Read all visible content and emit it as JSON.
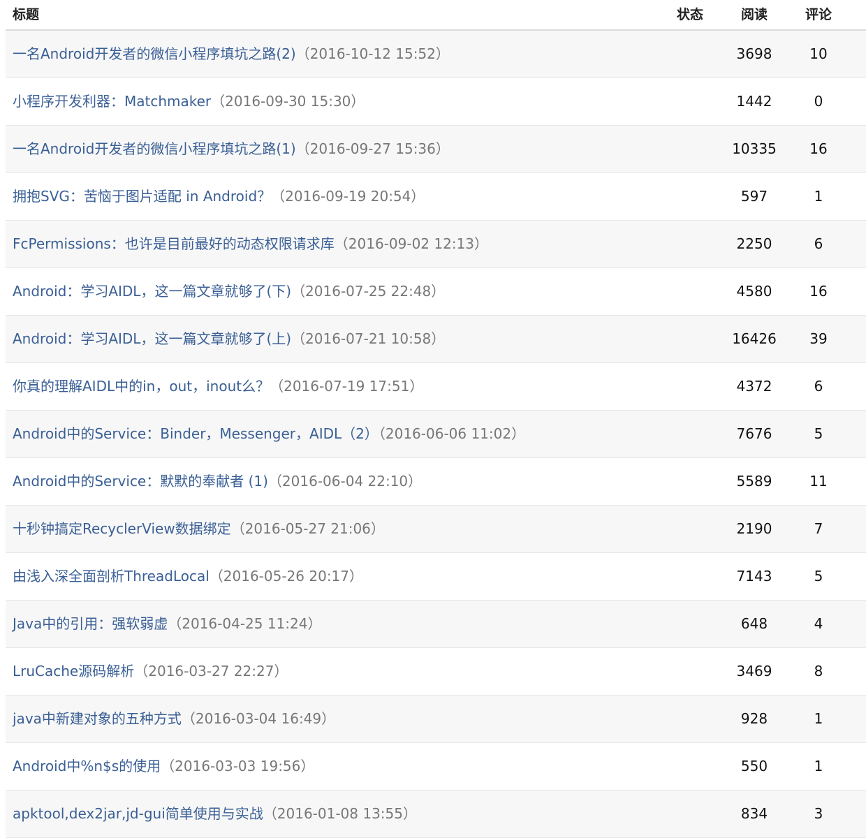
{
  "header": {
    "title": "标题",
    "status": "状态",
    "read": "阅读",
    "comment": "评论"
  },
  "rows": [
    {
      "title": "一名Android开发者的微信小程序填坑之路(2)",
      "date": "（2016-10-12 15:52）",
      "read": "3698",
      "comment": "10"
    },
    {
      "title": "小程序开发利器：Matchmaker",
      "date": "（2016-09-30 15:30）",
      "read": "1442",
      "comment": "0"
    },
    {
      "title": "一名Android开发者的微信小程序填坑之路(1)",
      "date": "（2016-09-27 15:36）",
      "read": "10335",
      "comment": "16"
    },
    {
      "title": "拥抱SVG：苦恼于图片适配 in Android？",
      "date": "（2016-09-19 20:54）",
      "read": "597",
      "comment": "1"
    },
    {
      "title": "FcPermissions：也许是目前最好的动态权限请求库",
      "date": "（2016-09-02 12:13）",
      "read": "2250",
      "comment": "6"
    },
    {
      "title": "Android：学习AIDL，这一篇文章就够了(下)",
      "date": "（2016-07-25 22:48）",
      "read": "4580",
      "comment": "16"
    },
    {
      "title": "Android：学习AIDL，这一篇文章就够了(上)",
      "date": "（2016-07-21 10:58）",
      "read": "16426",
      "comment": "39"
    },
    {
      "title": "你真的理解AIDL中的in，out，inout么？",
      "date": "（2016-07-19 17:51）",
      "read": "4372",
      "comment": "6"
    },
    {
      "title": "Android中的Service：Binder，Messenger，AIDL（2）",
      "date": "（2016-06-06 11:02）",
      "read": "7676",
      "comment": "5"
    },
    {
      "title": "Android中的Service：默默的奉献者 (1)",
      "date": "（2016-06-04 22:10）",
      "read": "5589",
      "comment": "11"
    },
    {
      "title": "十秒钟搞定RecyclerView数据绑定",
      "date": "（2016-05-27 21:06）",
      "read": "2190",
      "comment": "7"
    },
    {
      "title": "由浅入深全面剖析ThreadLocal",
      "date": "（2016-05-26 20:17）",
      "read": "7143",
      "comment": "5"
    },
    {
      "title": "Java中的引用：强软弱虚",
      "date": "（2016-04-25 11:24）",
      "read": "648",
      "comment": "4"
    },
    {
      "title": "LruCache源码解析",
      "date": "（2016-03-27 22:27）",
      "read": "3469",
      "comment": "8"
    },
    {
      "title": "java中新建对象的五种方式",
      "date": "（2016-03-04 16:49）",
      "read": "928",
      "comment": "1"
    },
    {
      "title": "Android中%n$s的使用",
      "date": "（2016-03-03 19:56）",
      "read": "550",
      "comment": "1"
    },
    {
      "title": "apktool,dex2jar,jd-gui简单使用与实战",
      "date": "（2016-01-08 13:55）",
      "read": "834",
      "comment": "3"
    }
  ]
}
